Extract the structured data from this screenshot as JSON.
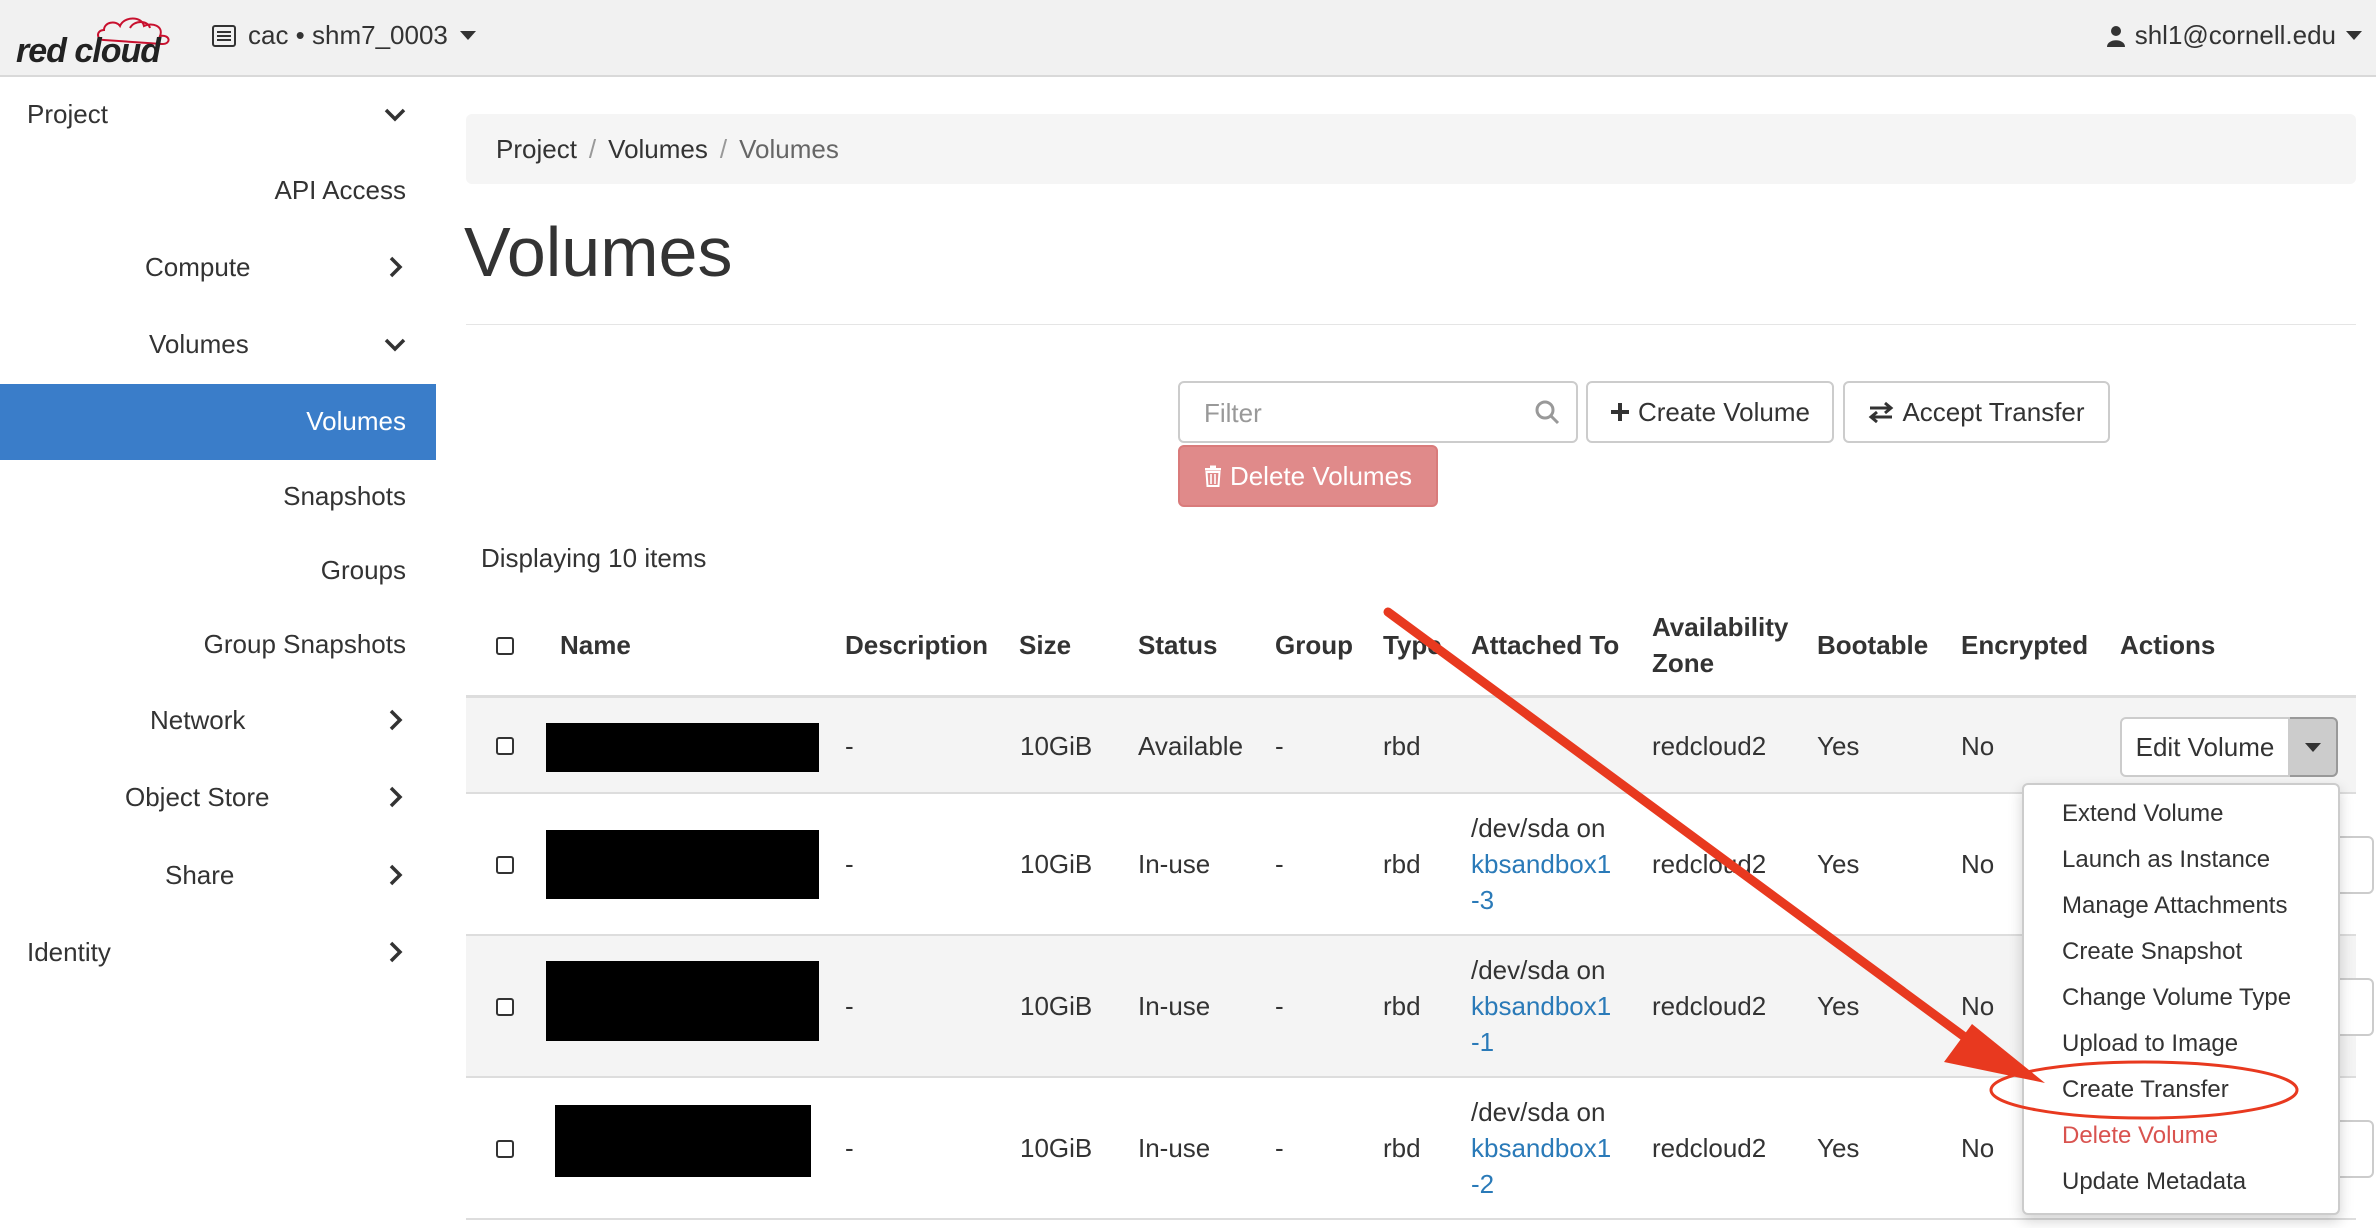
{
  "navbar": {
    "logo_text": "red cloud",
    "project_picker": "cac • shm7_0003",
    "user": "shl1@cornell.edu"
  },
  "sidebar": {
    "items": [
      {
        "label": "Project"
      },
      {
        "label": "API Access"
      },
      {
        "label": "Compute"
      },
      {
        "label": "Volumes"
      },
      {
        "label": "Volumes"
      },
      {
        "label": "Snapshots"
      },
      {
        "label": "Groups"
      },
      {
        "label": "Group Snapshots"
      },
      {
        "label": "Network"
      },
      {
        "label": "Object Store"
      },
      {
        "label": "Share"
      },
      {
        "label": "Identity"
      }
    ],
    "active_color": "#3a7dc9"
  },
  "breadcrumb": [
    "Project",
    "Volumes",
    "Volumes"
  ],
  "page_title": "Volumes",
  "toolbar": {
    "filter_placeholder": "Filter",
    "create_volume": "Create Volume",
    "accept_transfer": "Accept Transfer",
    "delete_volumes": "Delete Volumes"
  },
  "display_count": "Displaying 10 items",
  "table": {
    "headers": {
      "name": "Name",
      "description": "Description",
      "size": "Size",
      "status": "Status",
      "group": "Group",
      "type": "Type",
      "attached_to": "Attached To",
      "availability_zone_1": "Availability",
      "availability_zone_2": "Zone",
      "bootable": "Bootable",
      "encrypted": "Encrypted",
      "actions": "Actions"
    },
    "rows": [
      {
        "description": "-",
        "size": "10GiB",
        "status": "Available",
        "group": "-",
        "type": "rbd",
        "attached_prefix": "",
        "attached_link_1": "",
        "attached_link_2": "",
        "zone": "redcloud2",
        "bootable": "Yes",
        "encrypted": "No"
      },
      {
        "description": "-",
        "size": "10GiB",
        "status": "In-use",
        "group": "-",
        "type": "rbd",
        "attached_prefix": "/dev/sda on",
        "attached_link_1": "kbsandbox1",
        "attached_link_2": "-3",
        "zone": "redcloud2",
        "bootable": "Yes",
        "encrypted": "No"
      },
      {
        "description": "-",
        "size": "10GiB",
        "status": "In-use",
        "group": "-",
        "type": "rbd",
        "attached_prefix": "/dev/sda on",
        "attached_link_1": "kbsandbox1",
        "attached_link_2": "-1",
        "zone": "redcloud2",
        "bootable": "Yes",
        "encrypted": "No"
      },
      {
        "description": "-",
        "size": "10GiB",
        "status": "In-use",
        "group": "-",
        "type": "rbd",
        "attached_prefix": "/dev/sda on",
        "attached_link_1": "kbsandbox1",
        "attached_link_2": "-2",
        "zone": "redcloud2",
        "bootable": "Yes",
        "encrypted": "No"
      }
    ],
    "row_action": "Edit Volume"
  },
  "action_menu": {
    "items": [
      "Extend Volume",
      "Launch as Instance",
      "Manage Attachments",
      "Create Snapshot",
      "Change Volume Type",
      "Upload to Image",
      "Create Transfer",
      "Delete Volume",
      "Update Metadata"
    ]
  },
  "annotation": {
    "highlighted_item": "Create Transfer",
    "color": "#e8391f"
  },
  "icons": {
    "project_picker": "server-list-icon",
    "user": "user-icon",
    "filter": "search-icon",
    "create_volume": "plus-icon",
    "accept_transfer": "transfer-arrows-icon",
    "delete_volumes": "trash-icon"
  }
}
